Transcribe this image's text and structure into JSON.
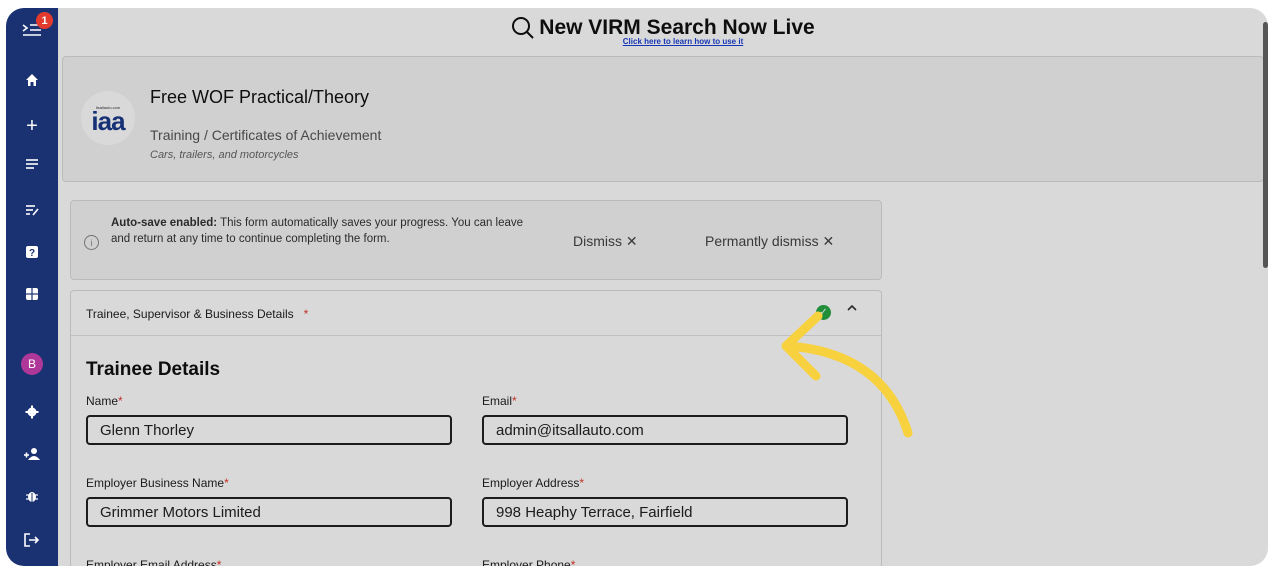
{
  "sidebar": {
    "badge": "1",
    "avatar": "B",
    "icons": [
      "menu-expand-icon",
      "home-icon",
      "plus-icon",
      "list-icon",
      "edit-list-icon",
      "help-icon",
      "calculator-icon",
      "gear-icon",
      "add-user-icon",
      "bug-icon",
      "logout-icon"
    ]
  },
  "topbar": {
    "title": "New VIRM Search Now Live",
    "link": "Click here to learn how to use it"
  },
  "course": {
    "logo_small": "itsallauto.com",
    "logo_text": "iaa",
    "title": "Free WOF Practical/Theory",
    "subtitle": "Training / Certificates of Achievement",
    "note": "Cars, trailers, and motorcycles"
  },
  "autosave": {
    "bold": "Auto-save enabled:",
    "text": " This form automatically saves your progress. You can leave and return at any time to continue completing the form.",
    "dismiss": "Dismiss",
    "perm_dismiss": "Permantly dismiss"
  },
  "section": {
    "title": "Trainee, Supervisor & Business Details",
    "required_mark": "*",
    "subheading": "Trainee Details",
    "fields": {
      "name_label": "Name",
      "name_value": "Glenn Thorley",
      "email_label": "Email",
      "email_value": "admin@itsallauto.com",
      "biz_label": "Employer Business Name",
      "biz_value": "Grimmer Motors Limited",
      "addr_label": "Employer Address",
      "addr_value": "998 Heaphy Terrace, Fairfield",
      "bemail_label": "Employer Email Address",
      "phone_label": "Employer Phone"
    }
  },
  "colors": {
    "sidebar": "#1a3272",
    "accent_arrow": "#f7d23e",
    "required": "#e23b2e",
    "check": "#27a745"
  }
}
